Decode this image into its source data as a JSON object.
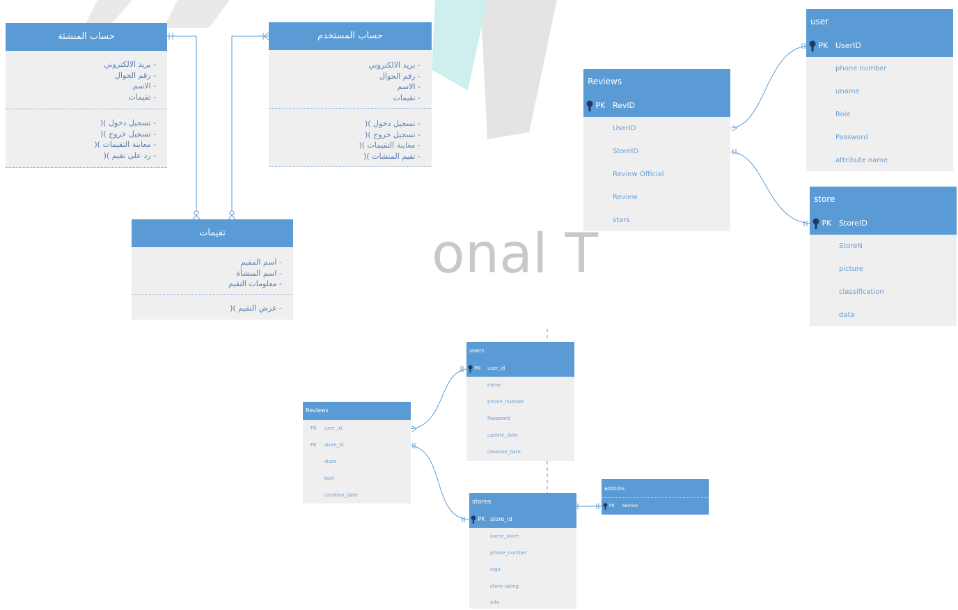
{
  "watermark": {
    "text": "onal T"
  },
  "erd_ar": {
    "creator": {
      "title": "حساب المنشئة",
      "attributes": [
        "- بريد الالكتروني",
        "- رقم الجوال",
        "- الاسم",
        "- تقيمات"
      ],
      "methods": [
        "- تسجيل دخول )(",
        "- تسجيل خروج )(",
        "- معاينة التقيمات )(",
        "- رد على تقيم )("
      ]
    },
    "user_account": {
      "title": "حساب المستخدم",
      "attributes": [
        "- بريد الالكتروني",
        "- رقم الجوال",
        "- الاسم",
        "- تقيمات"
      ],
      "methods": [
        "- تسجيل دخول )(",
        "- تسجيل خروج )(",
        "- معاينة التقيمات )(",
        "- تقيم المنشات )("
      ]
    },
    "ratings": {
      "title": "تقيمات",
      "attributes": [
        "- اسم المقيم",
        "- اسم المنشأة",
        "- معلومات التقيم"
      ],
      "methods": [
        "- عرض التقيم )("
      ]
    }
  },
  "erd1": {
    "reviews": {
      "title": "Reviews",
      "pk": "RevID",
      "fields": [
        "UserID",
        "StoreID",
        "Review  Official",
        "Review",
        "stars"
      ]
    },
    "user": {
      "title": "user",
      "pk": "UserID",
      "fields": [
        "phone number",
        "uname",
        "Role",
        "Password",
        "attribute name"
      ]
    },
    "store": {
      "title": "store",
      "pk": "StoreID",
      "fields": [
        "StoreN",
        "picture",
        "classification",
        "data"
      ]
    }
  },
  "erd2": {
    "reviews": {
      "title": "Reviews",
      "fk_label": "FK",
      "fk_fields": [
        "user_id",
        "store_id"
      ],
      "fields": [
        "stars",
        "text",
        "creation_date"
      ]
    },
    "users": {
      "title": "users",
      "pk": "user_id",
      "fields": [
        "name",
        "phone_number",
        "Password",
        "update_date",
        "creation_date"
      ]
    },
    "stores": {
      "title": "stores",
      "pk": "store_id",
      "fields": [
        "name_store",
        "phone_number",
        "logo",
        "store-rating",
        "info"
      ]
    },
    "admins": {
      "title": "admins",
      "pk": "admins"
    }
  },
  "pk_label": "PK",
  "colors": {
    "header": "#5b9bd5",
    "body": "#efefef",
    "connector": "#5b9bd5",
    "text": "#6a9fd4"
  }
}
